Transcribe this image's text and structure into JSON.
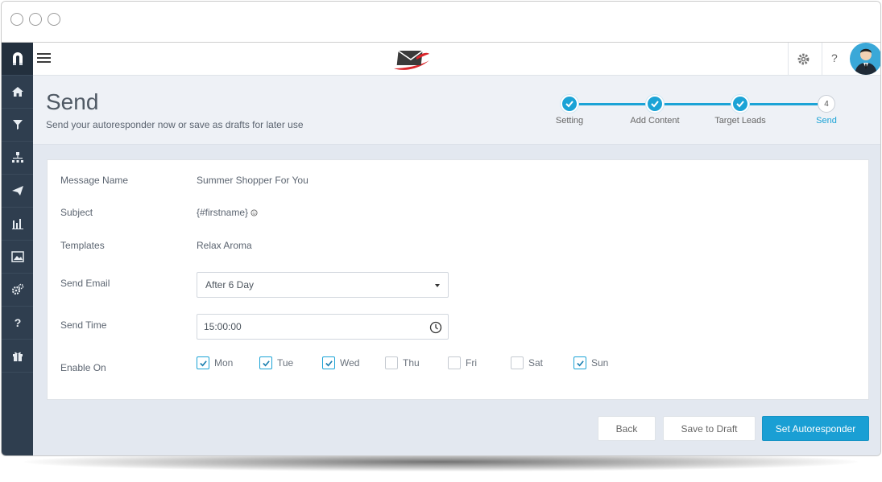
{
  "app": {
    "top_help": "?"
  },
  "header": {
    "title": "Send",
    "subtitle": "Send your autoresponder now or save as drafts for later use"
  },
  "stepper": {
    "steps": [
      {
        "label": "Setting",
        "state": "done"
      },
      {
        "label": "Add Content",
        "state": "done"
      },
      {
        "label": "Target Leads",
        "state": "done"
      },
      {
        "label": "Send",
        "state": "current",
        "number": "4"
      }
    ]
  },
  "form": {
    "message_name_label": "Message Name",
    "message_name_value": "Summer Shopper For You",
    "subject_label": "Subject",
    "subject_value": "{#firstname}",
    "templates_label": "Templates",
    "templates_value": "Relax Aroma",
    "send_email_label": "Send Email",
    "send_email_value": "After 6 Day",
    "send_time_label": "Send Time",
    "send_time_value": "15:00:00",
    "enable_on_label": "Enable On",
    "days": [
      {
        "label": "Mon",
        "checked": true
      },
      {
        "label": "Tue",
        "checked": true
      },
      {
        "label": "Wed",
        "checked": true
      },
      {
        "label": "Thu",
        "checked": false
      },
      {
        "label": "Fri",
        "checked": false
      },
      {
        "label": "Sat",
        "checked": false
      },
      {
        "label": "Sun",
        "checked": true
      }
    ]
  },
  "actions": {
    "back_label": "Back",
    "draft_label": "Save to Draft",
    "submit_label": "Set Autoresponder"
  },
  "colors": {
    "accent": "#1ba3d6",
    "sidebar": "#2f3e4f",
    "logo_red": "#d9252a"
  },
  "sidebar_icons": [
    "home-icon",
    "funnel-icon",
    "sitemap-icon",
    "send-icon",
    "bar-chart-icon",
    "image-icon",
    "gears-icon",
    "help-icon",
    "gift-icon"
  ]
}
